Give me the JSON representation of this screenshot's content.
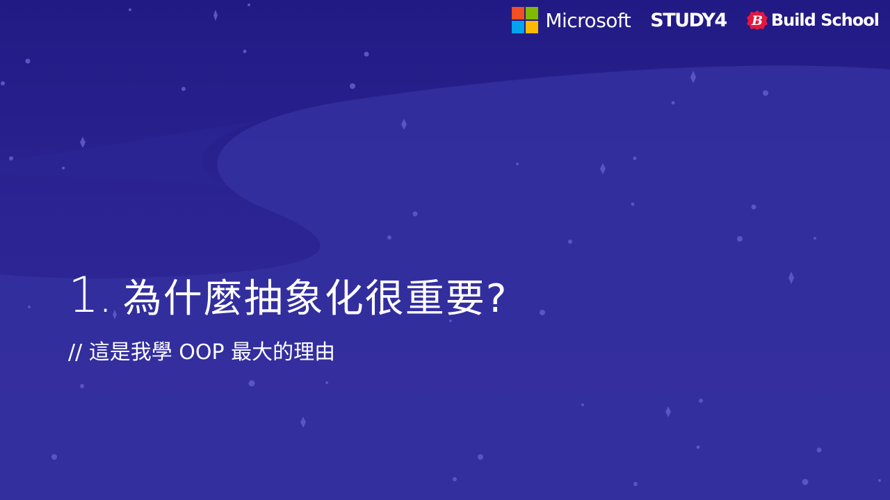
{
  "header": {
    "logos": {
      "microsoft": {
        "label": "Microsoft",
        "icon": "microsoft-logo-icon",
        "colors": [
          "#f25022",
          "#7fba00",
          "#00a4ef",
          "#ffb900"
        ]
      },
      "study4": {
        "label": "STUDY4"
      },
      "buildschool": {
        "label": "Build School",
        "icon": "build-school-badge-icon",
        "badge_color": "#e5173f"
      }
    }
  },
  "slide": {
    "title_number": "1.",
    "title_text": "為什麼抽象化很重要?",
    "subtitle": "// 這是我學 OOP 最大的理由"
  },
  "theme": {
    "background": "#2a2390",
    "wave": "#3a33a5",
    "star": "#5a55c4",
    "text": "#ffffff"
  }
}
